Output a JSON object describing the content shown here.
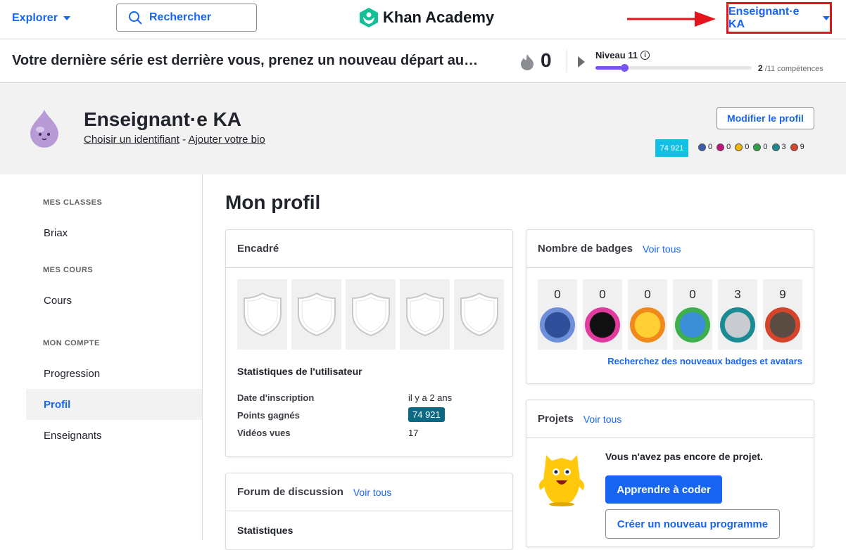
{
  "topnav": {
    "explorer_label": "Explorer",
    "search_label": "Rechercher",
    "logo_text": "Khan Academy",
    "user_label": "Enseignant·e KA"
  },
  "streak": {
    "message": "Votre dernière série est derrière vous, prenez un nouveau départ au…",
    "count": "0",
    "level_label": "Niveau 11",
    "level_progress": 0.18,
    "skills_done": "2",
    "skills_total": " /11 compétences"
  },
  "profile": {
    "name": "Enseignant·e KA",
    "choose_id": "Choisir un identifiant",
    "separator": " - ",
    "add_bio": "Ajouter votre bio",
    "edit_button": "Modifier le profil",
    "points": "74 921",
    "mini_badges": [
      {
        "count": "0",
        "color": "#3b5bab"
      },
      {
        "count": "0",
        "color": "#c2127d"
      },
      {
        "count": "0",
        "color": "#f2b705"
      },
      {
        "count": "0",
        "color": "#2ea343"
      },
      {
        "count": "3",
        "color": "#1b8a93"
      },
      {
        "count": "9",
        "color": "#d4452b"
      }
    ]
  },
  "sidebar": {
    "section_classes": "MES CLASSES",
    "item_briax": "Briax",
    "section_courses": "MES COURS",
    "item_courses": "Cours",
    "section_account": "MON COMPTE",
    "item_progress": "Progression",
    "item_profile": "Profil",
    "item_teachers": "Enseignants"
  },
  "main": {
    "title": "Mon profil",
    "encadre": {
      "title": "Encadré",
      "stats_title": "Statistiques de l'utilisateur",
      "rows": [
        {
          "label": "Date d'inscription",
          "value": "il y a 2 ans"
        },
        {
          "label": "Points gagnés",
          "value": "74 921"
        },
        {
          "label": "Vidéos vues",
          "value": "17"
        }
      ]
    },
    "badges": {
      "title": "Nombre de badges",
      "see_all": "Voir tous",
      "counts": [
        "0",
        "0",
        "0",
        "0",
        "3",
        "9"
      ],
      "link": "Recherchez des nouveaux badges et avatars"
    },
    "projects": {
      "title": "Projets",
      "see_all": "Voir tous",
      "empty": "Vous n'avez pas encore de projet.",
      "learn_button": "Apprendre à coder",
      "new_button": "Créer un nouveau programme"
    },
    "forum": {
      "title": "Forum de discussion",
      "see_all": "Voir tous",
      "stats": "Statistiques"
    }
  },
  "colors": {
    "accent": "#1865f2",
    "highlight_border": "#e3141b",
    "level": "#7854f7"
  }
}
